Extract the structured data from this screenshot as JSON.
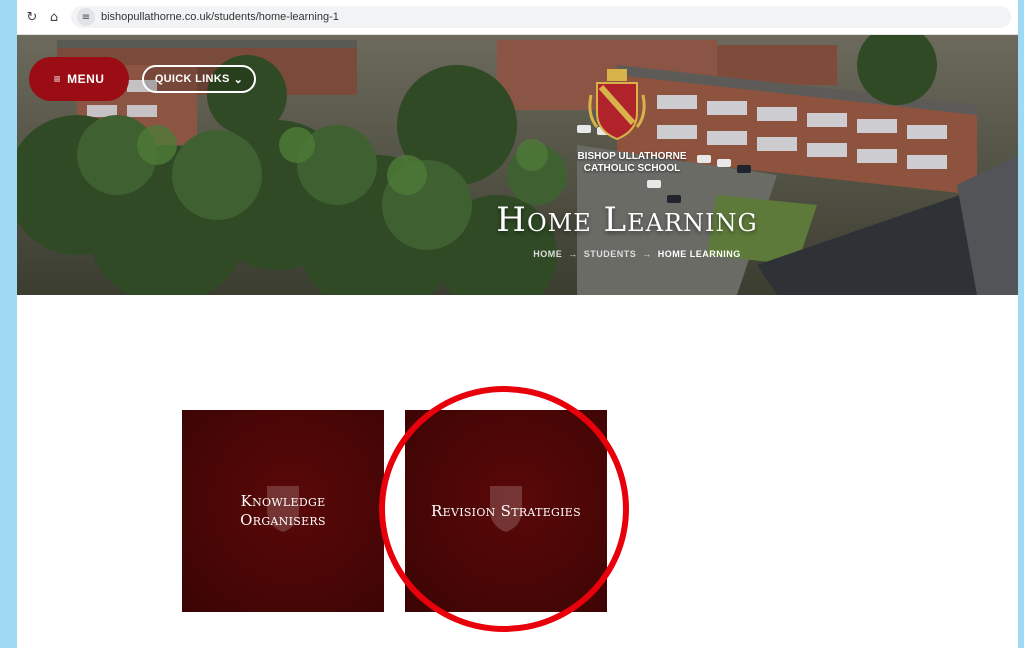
{
  "browser": {
    "url": "bishopullathorne.co.uk/students/home-learning-1"
  },
  "header": {
    "menu_label": "MENU",
    "quick_links_label": "QUICK LINKS",
    "school_name_line1": "BISHOP ULLATHORNE",
    "school_name_line2": "CATHOLIC SCHOOL",
    "page_title": "Home Learning",
    "breadcrumb": [
      "HOME",
      "STUDENTS",
      "HOME LEARNING"
    ]
  },
  "tiles": [
    {
      "label_line1": "Knowledge",
      "label_line2": "Organisers"
    },
    {
      "label": "Revision Strategies"
    }
  ],
  "colors": {
    "brand_red": "#9a0d14",
    "tile_maroon": "#4a0606",
    "highlight": "#e8000b",
    "frame": "#9fdaf4"
  },
  "icons": {
    "reload": "reload-icon",
    "home": "home-icon",
    "site_settings": "site-settings-icon",
    "menu": "hamburger-icon",
    "chevron": "chevron-down-icon",
    "arrow": "arrow-right-icon"
  }
}
